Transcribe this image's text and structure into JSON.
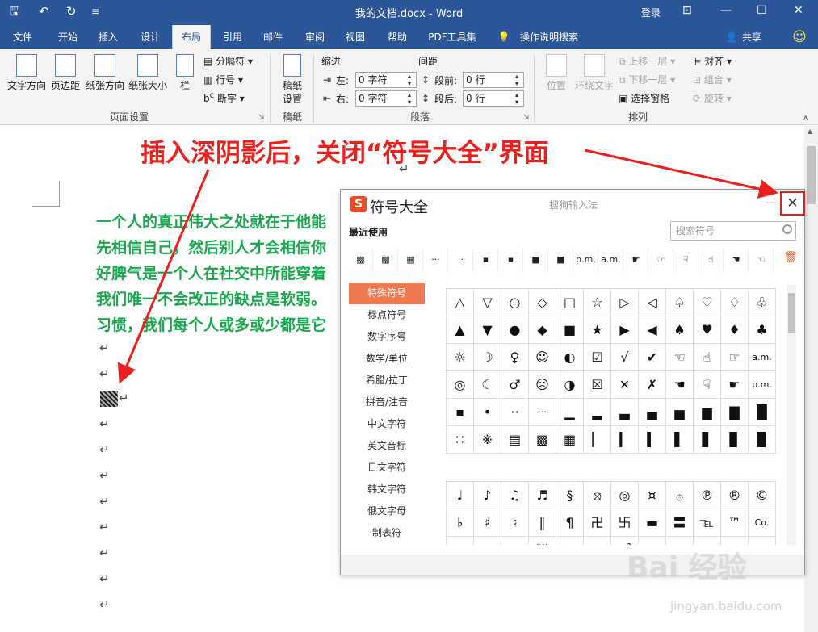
{
  "titlebar": {
    "save_icon": "save-icon",
    "undo_icon": "undo-icon",
    "redo_icon": "redo-icon",
    "title": "我的文档.docx  -  Word",
    "login": "登录"
  },
  "tabs": [
    "文件",
    "开始",
    "插入",
    "设计",
    "布局",
    "引用",
    "邮件",
    "审阅",
    "视图",
    "帮助",
    "PDF工具集",
    "操作说明搜索"
  ],
  "active_tab": "布局",
  "share": "共享",
  "ribbon": {
    "text_direction": "文字方向",
    "margins": "页边距",
    "orientation": "纸张方向",
    "size": "纸张大小",
    "columns": "栏",
    "breaks": "分隔符",
    "line_numbers": "行号",
    "hyphenation": "断字",
    "manuscript": "稿纸\n设置",
    "group_page_setup": "页面设置",
    "group_manuscript": "稿纸",
    "indent_label": "缩进",
    "spacing_label": "间距",
    "indent_left_label": "左:",
    "indent_left_value": "0 字符",
    "indent_right_label": "右:",
    "indent_right_value": "0 字符",
    "before_label": "段前:",
    "before_value": "0 行",
    "after_label": "段后:",
    "after_value": "0 行",
    "group_paragraph": "段落",
    "position": "位置",
    "wrap_text": "环绕文字",
    "bring_forward": "上移一层",
    "send_backward": "下移一层",
    "selection_pane": "选择窗格",
    "align": "对齐",
    "group": "组合",
    "rotate": "旋转",
    "group_arrange": "排列"
  },
  "document": {
    "lines": [
      "一个人的真正伟大之处就在于他能",
      "先相信自己，然后别人才会相信你",
      "好脾气是一个人在社交中所能穿着",
      "我们唯一不会改正的缺点是软弱。",
      "习惯，我们每个人或多或少都是它"
    ],
    "text_color": "#1aa84f"
  },
  "dialog": {
    "logo": "S",
    "title": "符号大全",
    "subtitle": "搜狗输入法",
    "min": "—",
    "close": "✕",
    "recent_label": "最近使用",
    "search_placeholder": "搜索符号",
    "recent": [
      "▩",
      "▩",
      "▦",
      "···",
      "··",
      "▪",
      "▪",
      "■",
      "■",
      "p.m.",
      "a.m.",
      "☛",
      "☞",
      "☟",
      "☝",
      "☚",
      "☜"
    ],
    "categories": [
      "特殊符号",
      "标点符号",
      "数字序号",
      "数学/单位",
      "希腊/拉丁",
      "拼音/注音",
      "中文字符",
      "英文音标",
      "日文字符",
      "韩文字符",
      "俄文字母",
      "制表符"
    ],
    "active_category": "特殊符号",
    "grid1": [
      [
        "△",
        "▽",
        "○",
        "◇",
        "□",
        "☆",
        "▷",
        "◁",
        "♤",
        "♡",
        "♢",
        "♧"
      ],
      [
        "▲",
        "▼",
        "●",
        "◆",
        "■",
        "★",
        "▶",
        "◀",
        "♠",
        "♥",
        "♦",
        "♣"
      ],
      [
        "☼",
        "☽",
        "♀",
        "☺",
        "◐",
        "☑",
        "√",
        "✔",
        "☜",
        "☝",
        "☞",
        "a.m."
      ],
      [
        "◎",
        "☾",
        "♂",
        "☹",
        "◑",
        "☒",
        "✕",
        "✗",
        "☚",
        "☟",
        "☛",
        "p.m."
      ],
      [
        "▪",
        "•",
        "··",
        "···",
        "▁",
        "▂",
        "▃",
        "▄",
        "▅",
        "▆",
        "▇",
        "█"
      ],
      [
        "∷",
        "※",
        "▤",
        "▩",
        "▦",
        "▏",
        "▎",
        "▍",
        "▌",
        "▋",
        "▊",
        "▉"
      ]
    ],
    "grid2": [
      [
        "♩",
        "♪",
        "♫",
        "♬",
        "§",
        "⦻",
        "◎",
        "¤",
        "۞",
        "℗",
        "®",
        "©"
      ],
      [
        "♭",
        "♯",
        "♮",
        "‖",
        "¶",
        "卍",
        "卐",
        "▬",
        "〓",
        "℡",
        "™",
        "Co."
      ],
      [
        "㏂",
        "㏘",
        "℡",
        "㈱",
        "㏇",
        "㏄",
        "㎡",
        "¤",
        "¤",
        "¤",
        "¤",
        "¤"
      ]
    ]
  },
  "annotation": {
    "text": "插入深阴影后，关闭“符号大全”界面",
    "color": "#e8211e"
  },
  "watermark": {
    "main": "Bai 经验",
    "sub": "jingyan.baidu.com"
  }
}
